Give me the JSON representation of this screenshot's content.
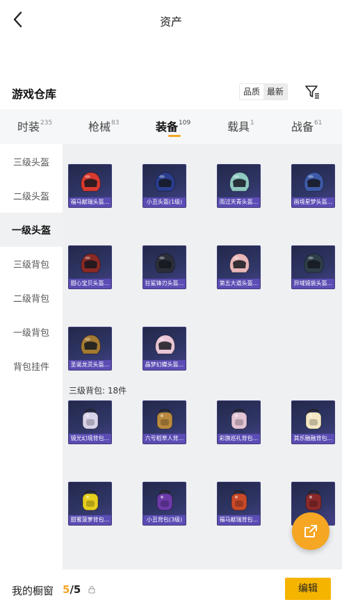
{
  "header": {
    "title": "资产"
  },
  "warehouse": {
    "title": "游戏仓库",
    "sort_quality": "品质",
    "sort_latest": "最新"
  },
  "tabs": [
    {
      "label": "时装",
      "count": "235"
    },
    {
      "label": "枪械",
      "count": "83"
    },
    {
      "label": "装备",
      "count": "109"
    },
    {
      "label": "载具",
      "count": "1"
    },
    {
      "label": "战备",
      "count": "61"
    }
  ],
  "sidebar": [
    {
      "label": "三级头盔"
    },
    {
      "label": "二级头盔"
    },
    {
      "label": "一级头盔"
    },
    {
      "label": "三级背包"
    },
    {
      "label": "二级背包"
    },
    {
      "label": "一级背包"
    },
    {
      "label": "背包挂件"
    }
  ],
  "helmets": [
    {
      "name": "福马献瑞头盔...",
      "color": "#d83a2e"
    },
    {
      "name": "小丑头盔(1级)",
      "color": "#2a3d8f"
    },
    {
      "name": "雨过天青头盔...",
      "color": "#8fc9c1"
    },
    {
      "name": "画境星梦头盔...",
      "color": "#3d5aa8"
    },
    {
      "name": "甜心宝贝头盔...",
      "color": "#8a2a25"
    },
    {
      "name": "狂鲨锋刃头盔...",
      "color": "#2c2f3a"
    },
    {
      "name": "第五大道头盔...",
      "color": "#e9b7b9"
    },
    {
      "name": "异域镜装头盔...",
      "color": "#2f3f4a"
    },
    {
      "name": "圣诞龙灵头盔...",
      "color": "#a47a32"
    },
    {
      "name": "晶梦幻蝶头盔...",
      "color": "#eac6d6"
    }
  ],
  "backpack_group": {
    "label": "三级背包: 18件"
  },
  "backpacks": [
    {
      "name": "镜光幻境背包...",
      "color": "#d9d3ea"
    },
    {
      "name": "六号稻草人背...",
      "color": "#b98a3f"
    },
    {
      "name": "彩旗巡礼背包...",
      "color": "#e3c4d4"
    },
    {
      "name": "其乐融融背包...",
      "color": "#f4e7c3"
    },
    {
      "name": "甜蜜菠萝背包...",
      "color": "#e6cf1e"
    },
    {
      "name": "小丑背包(3级)",
      "color": "#6b3aa8"
    },
    {
      "name": "福马献瑞背包...",
      "color": "#c84a2a"
    },
    {
      "name": "",
      "color": "#8a2a2a"
    }
  ],
  "bottom": {
    "label": "我的橱窗",
    "count_current": "5",
    "count_total": "/5",
    "edit_label": "编辑"
  },
  "colors": {
    "accent": "#f5a623"
  }
}
